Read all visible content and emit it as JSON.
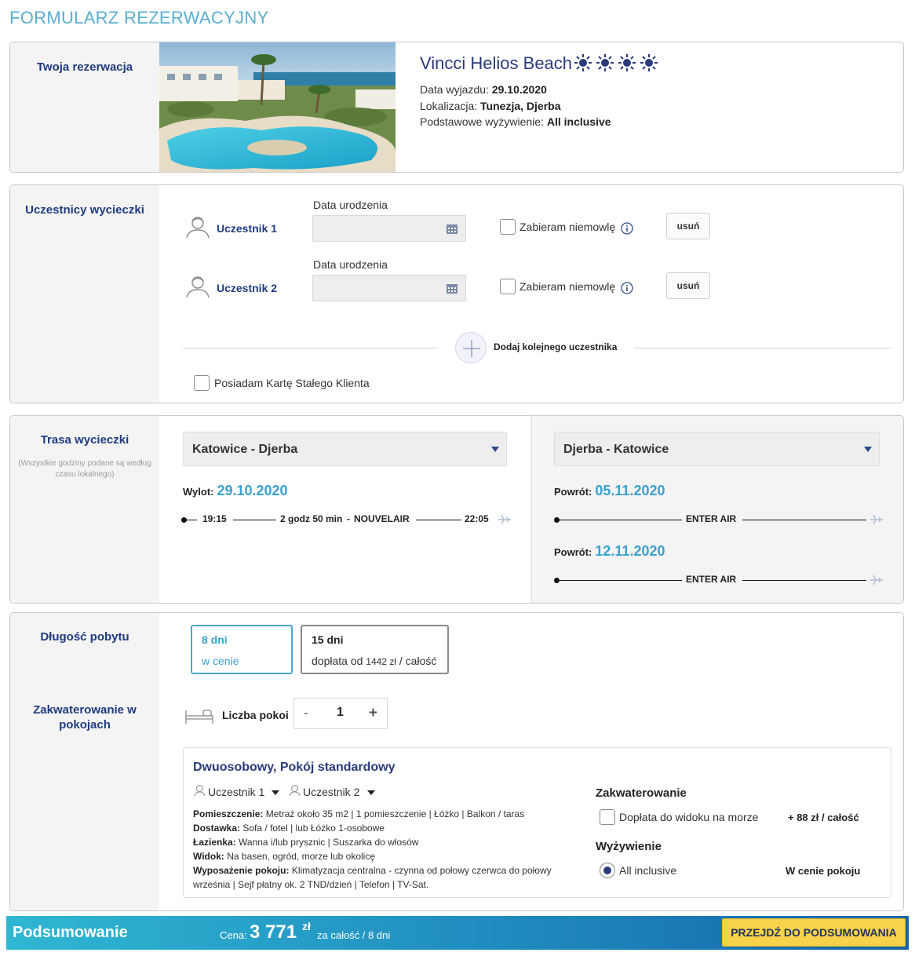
{
  "page_title": "FORMULARZ REZERWACYJNY",
  "reservation": {
    "label": "Twoja rezerwacja",
    "hotel_name": "Vincci Helios Beach",
    "stars": 4,
    "departure_label": "Data wyjazdu:",
    "departure_value": "29.10.2020",
    "location_label": "Lokalizacja:",
    "location_value": "Tunezja, Djerba",
    "board_label": "Podstawowe wyżywienie:",
    "board_value": "All inclusive"
  },
  "participants": {
    "label": "Uczestnicy wycieczki",
    "items": [
      {
        "name": "Uczestnik 1",
        "date_label": "Data urodzenia",
        "date_value": "",
        "infant_label": "Zabieram niemowlę",
        "remove_label": "usuń"
      },
      {
        "name": "Uczestnik 2",
        "date_label": "Data urodzenia",
        "date_value": "",
        "infant_label": "Zabieram niemowlę",
        "remove_label": "usuń"
      }
    ],
    "add_label": "Dodaj kolejnego uczestnika",
    "loyalty_label": "Posiadam Kartę Stałego Klienta"
  },
  "route": {
    "label": "Trasa wycieczki",
    "note": "(Wszystkie godziny podane są według czasu lokalnego)",
    "outbound": {
      "select": "Katowice - Djerba",
      "date_label": "Wylot:",
      "date": "29.10.2020",
      "dep_time": "19:15",
      "duration": "2 godz 50 min",
      "separator": "-",
      "airline": "NOUVELAIR",
      "arr_time": "22:05"
    },
    "inbound": {
      "select": "Djerba - Katowice",
      "options": [
        {
          "date_label": "Powrót:",
          "date": "05.11.2020",
          "airline": "ENTER AIR"
        },
        {
          "date_label": "Powrót:",
          "date": "12.11.2020",
          "airline": "ENTER AIR"
        }
      ]
    }
  },
  "stay": {
    "label": "Długość pobytu",
    "options": [
      {
        "days": "8 dni",
        "sub": "w cenie"
      },
      {
        "days": "15 dni",
        "sub_prefix": "doplata_placeholder",
        "sub": "dopłata od",
        "amount": "1442 zł",
        "suffix": "/ całość"
      }
    ]
  },
  "rooms": {
    "label": "Zakwaterowanie w pokojach",
    "count_label": "Liczba pokoi",
    "count": "1",
    "minus": "-",
    "plus": "+",
    "room": {
      "title": "Dwuosobowy, Pokój standardowy",
      "occupants": [
        "Uczestnik 1",
        "Uczestnik 2"
      ],
      "features": [
        {
          "label": "Pomieszczenie:",
          "value": "Metraż około 35 m2 | 1 pomieszczenie | Łóżko | Balkon / taras"
        },
        {
          "label": "Dostawka:",
          "value": "Sofa / fotel | lub Łóżko 1-osobowe"
        },
        {
          "label": "Łazienka:",
          "value": "Wanna i/lub prysznic | Suszarka do włosów"
        },
        {
          "label": "Widok:",
          "value": "Na basen, ogród, morze lub okolicę"
        },
        {
          "label": "Wyposażenie pokoju:",
          "value": "Klimatyzacja centralna - czynna od połowy czerwca do połowy września | Sejf płatny ok. 2 TND/dzień | Telefon | TV-Sat."
        }
      ],
      "accommodation_head": "Zakwaterowanie",
      "sea_view_label": "Dopłata do widoku na morze",
      "sea_view_price": "+ 88 zł / całość",
      "board_head": "Wyżywienie",
      "board_option": "All inclusive",
      "board_price": "W cenie pokoju"
    }
  },
  "footer": {
    "summary_label": "Podsumowanie",
    "price_label": "Cena:",
    "price_value": "3 771",
    "currency": "zł",
    "price_sub": "za całość / 8 dni",
    "cta": "PRZEJDŹ DO PODSUMOWANIA"
  },
  "colors": {
    "accent_blue": "#3aa2cf",
    "navy": "#1f3b80",
    "cta_yellow": "#f7d24a"
  }
}
